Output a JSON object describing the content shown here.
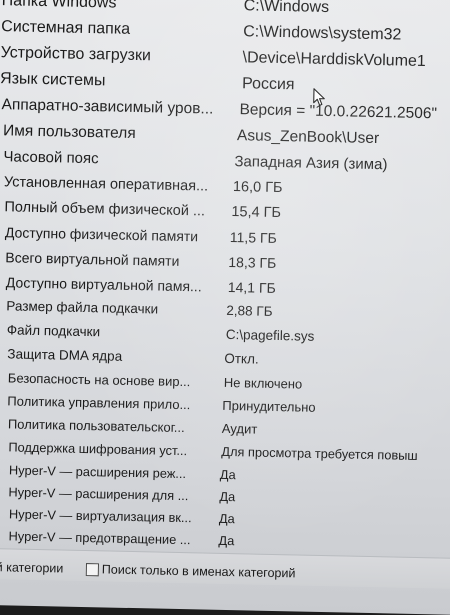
{
  "rows": [
    {
      "name": "Папка Windows",
      "value": "C:\\Windows"
    },
    {
      "name": "Системная папка",
      "value": "C:\\Windows\\system32"
    },
    {
      "name": "Устройство загрузки",
      "value": "\\Device\\HarddiskVolume1"
    },
    {
      "name": "Язык системы",
      "value": "Россия"
    },
    {
      "name": "Аппаратно-зависимый уров...",
      "value": "Версия = \"10.0.22621.2506\""
    },
    {
      "name": "Имя пользователя",
      "value": "Asus_ZenBook\\User"
    },
    {
      "name": "Часовой пояс",
      "value": "Западная Азия (зима)"
    },
    {
      "name": "Установленная оперативная...",
      "value": "16,0 ГБ"
    },
    {
      "name": "Полный объем физической ...",
      "value": "15,4 ГБ"
    },
    {
      "name": "Доступно физической памяти",
      "value": "11,5 ГБ"
    },
    {
      "name": "Всего виртуальной памяти",
      "value": "18,3 ГБ"
    },
    {
      "name": "Доступно виртуальной памя...",
      "value": "14,1 ГБ"
    },
    {
      "name": "Размер файла подкачки",
      "value": "2,88 ГБ"
    },
    {
      "name": "Файл подкачки",
      "value": "C:\\pagefile.sys"
    },
    {
      "name": "Защита DMA ядра",
      "value": "Откл."
    },
    {
      "name": "Безопасность на основе вир...",
      "value": "Не включено"
    },
    {
      "name": "Политика управления прило...",
      "value": "Принудительно"
    },
    {
      "name": "Политика пользовательског...",
      "value": "Аудит"
    },
    {
      "name": "Поддержка шифрования уст...",
      "value": "Для просмотра требуется повыш"
    },
    {
      "name": "Hyper-V — расширения реж...",
      "value": "Да"
    },
    {
      "name": "Hyper-V — расширения для ...",
      "value": "Да"
    },
    {
      "name": "Hyper-V — виртуализация вк...",
      "value": "Да"
    },
    {
      "name": "Hyper-V — предотвращение ...",
      "value": "Да"
    }
  ],
  "bottom": {
    "left_label": "ной категории",
    "checkbox_label": "Поиск только в именах категорий"
  },
  "icons": {
    "cursor": "mouse-pointer-icon"
  }
}
